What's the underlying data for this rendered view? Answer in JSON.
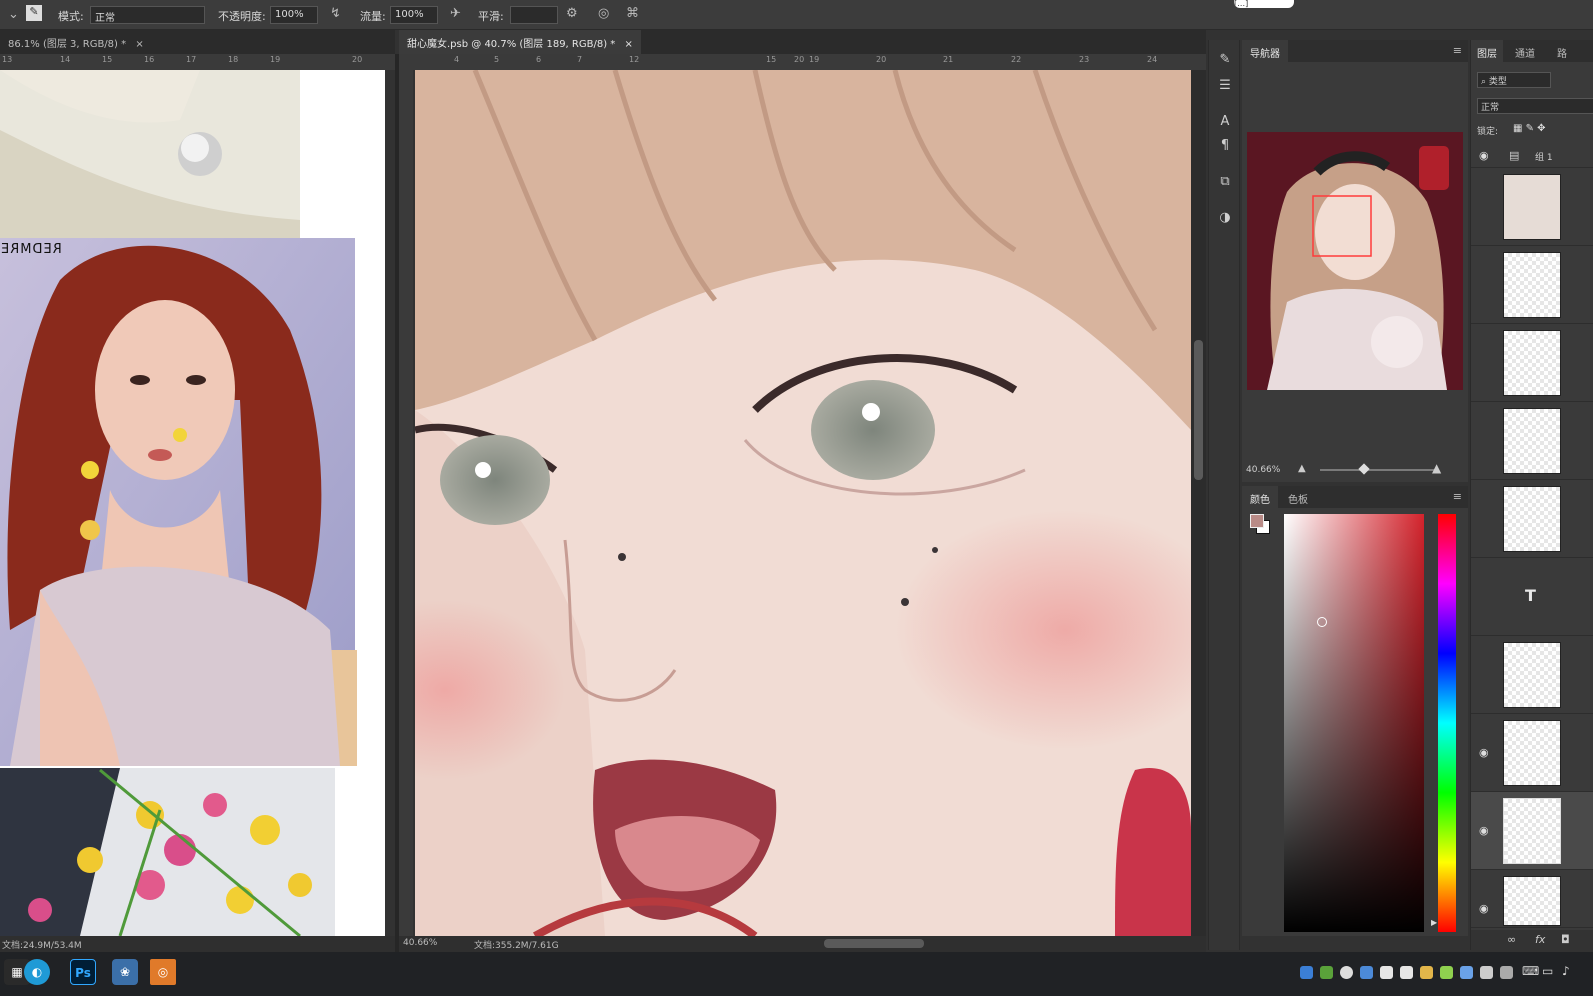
{
  "notice": "[…]",
  "options_bar": {
    "mode_label": "模式:",
    "mode_value": "正常",
    "opacity_label": "不透明度:",
    "opacity_value": "100%",
    "flow_label": "流量:",
    "flow_value": "100%",
    "smooth_label": "平滑:"
  },
  "tabs": {
    "left_doc": "86.1% (图层 3, RGB/8) *",
    "main_doc": "甜心魔女.psb @ 40.7% (图层 189, RGB/8) *",
    "close_glyph": "×"
  },
  "rulers": {
    "left_top": [
      "13",
      "14",
      "15",
      "16",
      "17",
      "18",
      "19",
      "20"
    ],
    "main_top": [
      "4",
      "5",
      "6",
      "7",
      "12",
      "15",
      "20",
      "19",
      "20",
      "21",
      "22",
      "23",
      "24"
    ]
  },
  "left_doc": {
    "magazine_text": "REDMRE",
    "status": "文档:24.9M/53.4M"
  },
  "main_status": {
    "zoom": "40.66%",
    "doc_size": "文档:355.2M/7.61G"
  },
  "navigator": {
    "tab": "导航器",
    "zoom": "40.66%"
  },
  "color_panel": {
    "tabs": [
      "颜色",
      "色板"
    ],
    "foreground": "#b98b87",
    "background": "#ffffff",
    "hue_color": "#d4232c"
  },
  "layers_panel": {
    "tabs": [
      "图层",
      "通道",
      "路"
    ],
    "filter_label": "类型",
    "blend_mode": "正常",
    "lock_label": "锁定:",
    "group_name": "组 1",
    "text_layer_glyph": "T",
    "footer_fx": "fx"
  },
  "taskbar": {
    "ps_label": "Ps"
  }
}
